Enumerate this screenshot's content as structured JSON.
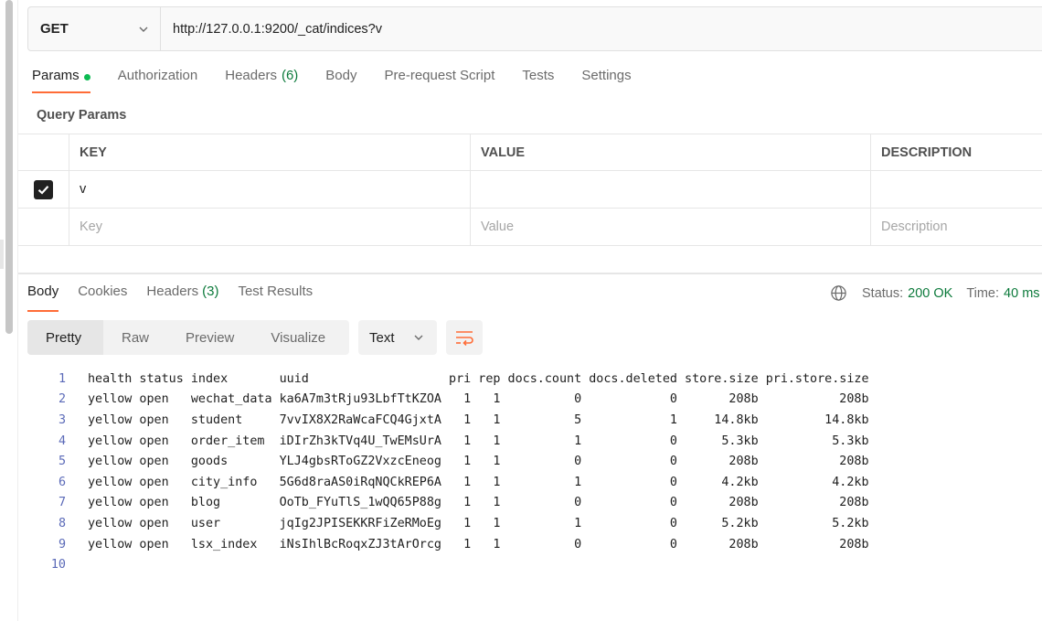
{
  "request": {
    "method": "GET",
    "url": "http://127.0.0.1:9200/_cat/indices?v"
  },
  "request_tabs": [
    {
      "label": "Params",
      "count": "",
      "dot": true
    },
    {
      "label": "Authorization",
      "count": ""
    },
    {
      "label": "Headers",
      "count": "(6)"
    },
    {
      "label": "Body",
      "count": ""
    },
    {
      "label": "Pre-request Script",
      "count": ""
    },
    {
      "label": "Tests",
      "count": ""
    },
    {
      "label": "Settings",
      "count": ""
    }
  ],
  "query_params": {
    "title": "Query Params",
    "headers": {
      "key": "KEY",
      "value": "VALUE",
      "description": "DESCRIPTION"
    },
    "rows": [
      {
        "key": "v",
        "value": "",
        "description": "",
        "checked": true
      }
    ],
    "placeholders": {
      "key": "Key",
      "value": "Value",
      "description": "Description"
    }
  },
  "response_tabs": [
    {
      "label": "Body",
      "count": ""
    },
    {
      "label": "Cookies",
      "count": ""
    },
    {
      "label": "Headers",
      "count": "(3)"
    },
    {
      "label": "Test Results",
      "count": ""
    }
  ],
  "response_status": {
    "status_label": "Status:",
    "status_value": "200 OK",
    "time_label": "Time:",
    "time_value": "40 ms"
  },
  "view_modes": [
    "Pretty",
    "Raw",
    "Preview",
    "Visualize"
  ],
  "format": "Text",
  "body_lines": [
    {
      "n": "1",
      "text": "health status index       uuid                   pri rep docs.count docs.deleted store.size pri.store.size"
    },
    {
      "n": "2",
      "text": "yellow open   wechat_data ka6A7m3tRju93LbfTtKZOA   1   1          0            0       208b           208b"
    },
    {
      "n": "3",
      "text": "yellow open   student     7vvIX8X2RaWcaFCQ4GjxtA   1   1          5            1     14.8kb         14.8kb"
    },
    {
      "n": "4",
      "text": "yellow open   order_item  iDIrZh3kTVq4U_TwEMsUrA   1   1          1            0      5.3kb          5.3kb"
    },
    {
      "n": "5",
      "text": "yellow open   goods       YLJ4gbsRToGZ2VxzcEneog   1   1          0            0       208b           208b"
    },
    {
      "n": "6",
      "text": "yellow open   city_info   5G6d8raAS0iRqNQCkREP6A   1   1          1            0      4.2kb          4.2kb"
    },
    {
      "n": "7",
      "text": "yellow open   blog        OoTb_FYuTlS_1wQQ65P88g   1   1          0            0       208b           208b"
    },
    {
      "n": "8",
      "text": "yellow open   user        jqIg2JPISEKKRFiZeRMoEg   1   1          1            0      5.2kb          5.2kb"
    },
    {
      "n": "9",
      "text": "yellow open   lsx_index   iNsIhlBcRoqxZJ3tArOrcg   1   1          0            0       208b           208b"
    },
    {
      "n": "10",
      "text": ""
    }
  ]
}
